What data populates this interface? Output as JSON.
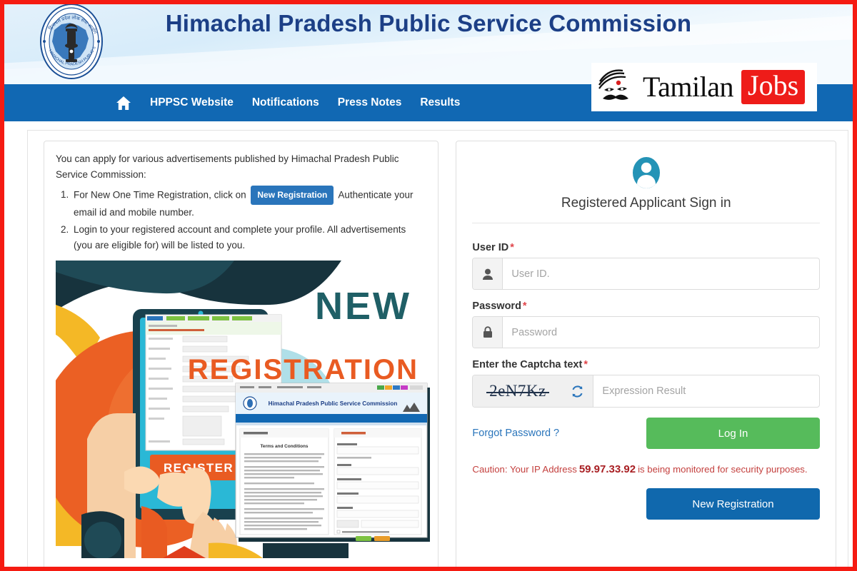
{
  "header": {
    "title": "Himachal Pradesh Public Service Commission",
    "logo_alt": "hppsc-emblem"
  },
  "nav": {
    "home_icon": "home-icon",
    "items": [
      {
        "label": "HPPSC Website"
      },
      {
        "label": "Notifications"
      },
      {
        "label": "Press Notes"
      },
      {
        "label": "Results"
      }
    ]
  },
  "watermark": {
    "name": "Tamilan",
    "highlight": "Jobs"
  },
  "left_panel": {
    "intro": "You can apply for various advertisements published by Himachal Pradesh Public Service Commission:",
    "item1_before": "For New One Time Registration, click on",
    "item1_button": "New Registration",
    "item1_after": "Authenticate your email id and mobile number.",
    "item2": "Login to your registered account and complete your profile. All advertisements (you are eligible for) will be listed to you.",
    "illustration": {
      "headline_top": "NEW",
      "headline_bottom": "REGISTRATION",
      "tablet_button": "REGISTER",
      "browser_title": "Himachal Pradesh Public Service Commission",
      "browser_section_title": "Terms and Conditions"
    }
  },
  "signin": {
    "avatar_icon": "user-avatar-icon",
    "title": "Registered Applicant Sign in",
    "user_id_label": "User ID",
    "user_id_placeholder": "User ID.",
    "user_id_value": "",
    "user_icon": "person-icon",
    "password_label": "Password",
    "password_placeholder": "Password",
    "password_value": "",
    "lock_icon": "lock-icon",
    "captcha_label": "Enter the Captcha text",
    "captcha_text": "2eN7Kz",
    "captcha_refresh_icon": "refresh-icon",
    "captcha_placeholder": "Expression Result",
    "captcha_value": "",
    "required_mark": "*",
    "forgot_password": "Forgot Password ?",
    "login_button": "Log In",
    "caution_prefix": "Caution: Your IP Address",
    "ip_address": "59.97.33.92",
    "caution_suffix": "is being monitored for security purposes.",
    "new_registration_button": "New Registration"
  },
  "colors": {
    "nav_blue": "#1168b3",
    "title_navy": "#1c3f86",
    "login_green": "#56bb5b",
    "newreg_blue": "#1068ad",
    "caution_red": "#c4413f",
    "link_blue": "#2a75bb",
    "frame_red": "#f51b12"
  }
}
